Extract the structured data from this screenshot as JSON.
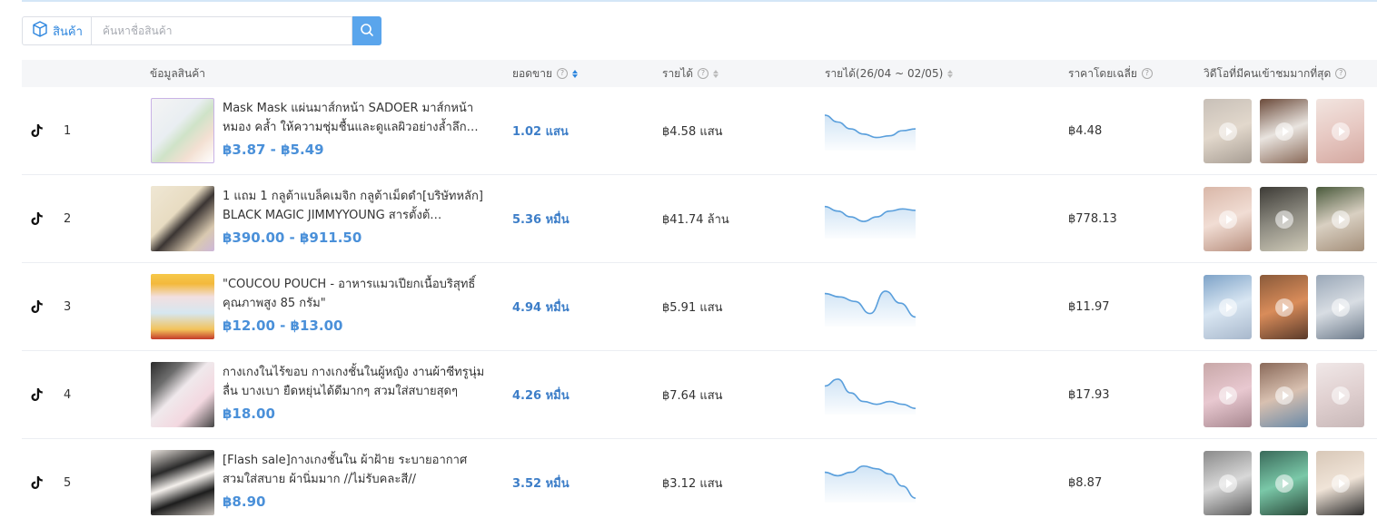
{
  "search": {
    "category_label": "สินค้า",
    "placeholder": "ค้นหาชื่อสินค้า",
    "category_icon": "box-icon",
    "button_icon": "search-icon"
  },
  "table": {
    "headers": {
      "product": "ข้อมูลสินค้า",
      "sales": "ยอดขาย",
      "revenue": "รายได้",
      "trend": "รายได้(26/04 ~ 02/05)",
      "avg_price": "ราคาโดยเฉลี่ย",
      "top_videos": "วิดีโอที่มีคนเข้าชมมากที่สุด"
    },
    "rows": [
      {
        "rank": "1",
        "name": "Mask Mask แผ่นมาส์กหน้า SADOER มาส์กหน้า หมอง คล้ำ ให้ความชุ่มชื้นและดูแลผิวอย่างล้ำลึก…",
        "price": "฿3.87 - ฿5.49",
        "sales": "1.02 แสน",
        "revenue": "฿4.58 แสน",
        "avg_price": "฿4.48",
        "trend": [
          0.95,
          0.75,
          0.55,
          0.4,
          0.3,
          0.35,
          0.5,
          0.55
        ]
      },
      {
        "rank": "2",
        "name": "1 แถม 1 กลูต้าแบล็คเมจิก กลูต้าเม็ดดำ[บริษัทหลัก] BLACK MAGIC JIMMYYOUNG สารตั้งต้…",
        "price": "฿390.00 - ฿911.50",
        "sales": "5.36 หมื่น",
        "revenue": "฿41.74 ล้าน",
        "avg_price": "฿778.13",
        "trend": [
          0.85,
          0.72,
          0.55,
          0.42,
          0.55,
          0.72,
          0.78,
          0.74
        ]
      },
      {
        "rank": "3",
        "name": "\"COUCOU POUCH - อาหารแมวเปียกเนื้อบริสุทธิ์คุณภาพสูง 85 กรัม\"",
        "price": "฿12.00 - ฿13.00",
        "sales": "4.94 หมื่น",
        "revenue": "฿5.91 แสน",
        "avg_price": "฿11.97",
        "trend": [
          0.88,
          0.78,
          0.65,
          0.3,
          0.95,
          0.6,
          0.2
        ]
      },
      {
        "rank": "4",
        "name": "กางเกงในไร้ขอบ กางเกงชั้นในผู้หญิง งานผ้าซีทรูนุ่มลื่น บางเบา ยืดหยุ่นได้ดีมากๆ สวมใส่สบายสุดๆ",
        "price": "฿18.00",
        "sales": "4.26 หมื่น",
        "revenue": "฿7.64 แสน",
        "avg_price": "฿17.93",
        "trend": [
          0.75,
          0.95,
          0.55,
          0.3,
          0.22,
          0.3,
          0.22,
          0.1
        ]
      },
      {
        "rank": "5",
        "name": "[Flash sale]กางเกงชั้นใน ผ้าฝ้าย ระบายอากาศ สวมใส่สบาย ผ้านิ่มมาก //ไม่รับคละสี//",
        "price": "฿8.90",
        "sales": "3.52 หมื่น",
        "revenue": "฿3.12 แสน",
        "avg_price": "฿8.87",
        "trend": [
          0.8,
          0.7,
          0.8,
          0.98,
          0.9,
          0.75,
          0.4,
          0.05
        ]
      }
    ]
  },
  "colors": {
    "accent": "#4a90d9",
    "sparkline": "#5a9fdc",
    "header_bg": "#f5f6f8"
  }
}
